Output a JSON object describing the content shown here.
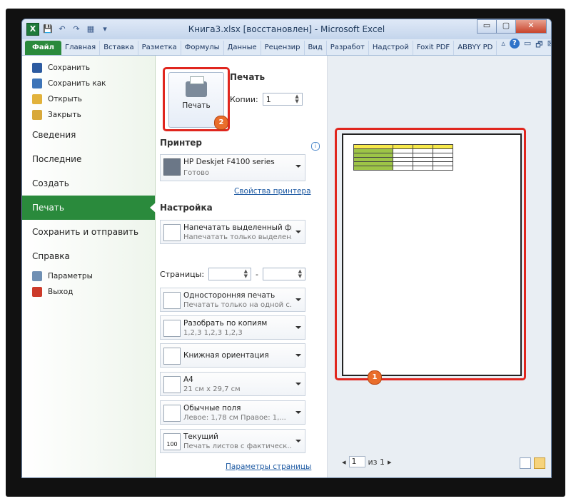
{
  "window": {
    "title": "Книга3.xlsx [восстановлен] - Microsoft Excel",
    "app_icon": "X",
    "buttons": {
      "minimize": "▭",
      "maximize": "▢",
      "close": "✕"
    }
  },
  "quick_access": {
    "save": "💾",
    "undo": "↶",
    "redo": "↷",
    "extra": "▦",
    "customize": "▾"
  },
  "ribbon_tabs": [
    "Файл",
    "Главная",
    "Вставка",
    "Разметка",
    "Формулы",
    "Данные",
    "Рецензир",
    "Вид",
    "Разработ",
    "Надстрой",
    "Foxit PDF",
    "ABBYY PD"
  ],
  "ribbon_right": {
    "up": "▵",
    "help": "?",
    "minimize": "▭",
    "restore": "🗗",
    "close": "⊠"
  },
  "backstage": {
    "small_items": [
      {
        "label": "Сохранить",
        "icon": "save-icon",
        "color": "#2c5aa0"
      },
      {
        "label": "Сохранить как",
        "icon": "save-as-icon",
        "color": "#3d74b8"
      },
      {
        "label": "Открыть",
        "icon": "open-folder-icon",
        "color": "#e2b23c"
      },
      {
        "label": "Закрыть",
        "icon": "close-file-icon",
        "color": "#d8a83a"
      }
    ],
    "big_items": [
      "Сведения",
      "Последние",
      "Создать",
      "Печать",
      "Сохранить и отправить",
      "Справка"
    ],
    "selected": "Печать",
    "bottom_items": [
      {
        "label": "Параметры",
        "icon": "options-icon",
        "color": "#6f8fb3"
      },
      {
        "label": "Выход",
        "icon": "exit-icon",
        "color": "#cc3a2a"
      }
    ]
  },
  "print": {
    "header": "Печать",
    "button_label": "Печать",
    "copies_label": "Копии:",
    "copies_value": "1",
    "printer_section": "Принтер",
    "printer_name": "HP Deskjet F4100 series",
    "printer_status": "Готово",
    "printer_props_link": "Свойства принтера",
    "settings_section": "Настройка",
    "settings": [
      {
        "t1": "Напечатать выделенный фр...",
        "t2": "Напечатать только выделен..."
      },
      {
        "t1": "Односторонняя печать",
        "t2": "Печатать только на одной с..."
      },
      {
        "t1": "Разобрать по копиям",
        "t2": "1,2,3    1,2,3    1,2,3"
      },
      {
        "t1": "Книжная ориентация",
        "t2": ""
      },
      {
        "t1": "A4",
        "t2": "21 см x 29,7 см"
      },
      {
        "t1": "Обычные поля",
        "t2": "Левое: 1,78 см    Правое: 1,..."
      },
      {
        "t1": "Текущий",
        "t2": "Печать листов с фактическ..."
      }
    ],
    "pages_label": "Страницы:",
    "pages_dash": "-",
    "page_setup_link": "Параметры страницы",
    "scale_badge": "100"
  },
  "preview": {
    "current_page": "1",
    "of_label": "из 1",
    "prev": "◂",
    "next": "▸"
  },
  "callouts": {
    "badge1": "1",
    "badge2": "2",
    "highlight_color": "#e0261e"
  }
}
